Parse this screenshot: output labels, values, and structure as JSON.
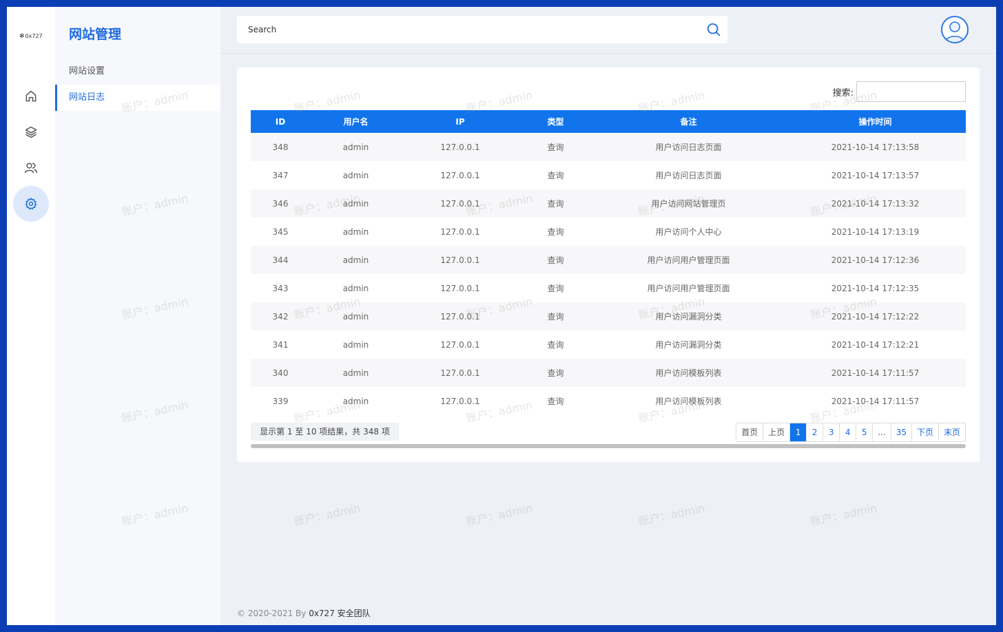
{
  "app": {
    "logo_text": "0x727",
    "accent_color": "#1174ec"
  },
  "rail": {
    "items": [
      {
        "icon": "home-icon"
      },
      {
        "icon": "layers-icon"
      },
      {
        "icon": "users-icon"
      },
      {
        "icon": "gear-icon",
        "active": true
      }
    ]
  },
  "subnav": {
    "title": "网站管理",
    "items": [
      {
        "label": "网站设置"
      },
      {
        "label": "网站日志",
        "active": true
      }
    ]
  },
  "header": {
    "search_placeholder": "Search"
  },
  "table": {
    "search_label": "搜索:",
    "search_value": "",
    "columns": [
      "ID",
      "用户名",
      "IP",
      "类型",
      "备注",
      "操作时间"
    ],
    "rows": [
      [
        "348",
        "admin",
        "127.0.0.1",
        "查询",
        "用户访问日志页面",
        "2021-10-14 17:13:58"
      ],
      [
        "347",
        "admin",
        "127.0.0.1",
        "查询",
        "用户访问日志页面",
        "2021-10-14 17:13:57"
      ],
      [
        "346",
        "admin",
        "127.0.0.1",
        "查询",
        "用户访问网站管理页",
        "2021-10-14 17:13:32"
      ],
      [
        "345",
        "admin",
        "127.0.0.1",
        "查询",
        "用户访问个人中心",
        "2021-10-14 17:13:19"
      ],
      [
        "344",
        "admin",
        "127.0.0.1",
        "查询",
        "用户访问用户管理页面",
        "2021-10-14 17:12:36"
      ],
      [
        "343",
        "admin",
        "127.0.0.1",
        "查询",
        "用户访问用户管理页面",
        "2021-10-14 17:12:35"
      ],
      [
        "342",
        "admin",
        "127.0.0.1",
        "查询",
        "用户访问漏洞分类",
        "2021-10-14 17:12:22"
      ],
      [
        "341",
        "admin",
        "127.0.0.1",
        "查询",
        "用户访问漏洞分类",
        "2021-10-14 17:12:21"
      ],
      [
        "340",
        "admin",
        "127.0.0.1",
        "查询",
        "用户访问模板列表",
        "2021-10-14 17:11:57"
      ],
      [
        "339",
        "admin",
        "127.0.0.1",
        "查询",
        "用户访问模板列表",
        "2021-10-14 17:11:57"
      ]
    ],
    "info": "显示第 1 至 10 项结果，共 348 项",
    "pager": {
      "first": "首页",
      "prev": "上页",
      "pages": [
        "1",
        "2",
        "3",
        "4",
        "5",
        "...",
        "35"
      ],
      "current": "1",
      "next": "下页",
      "last": "末页"
    }
  },
  "footer": {
    "prefix": "© 2020-2021 By ",
    "team": "0x727 安全团队"
  },
  "watermark": "账户：admin"
}
